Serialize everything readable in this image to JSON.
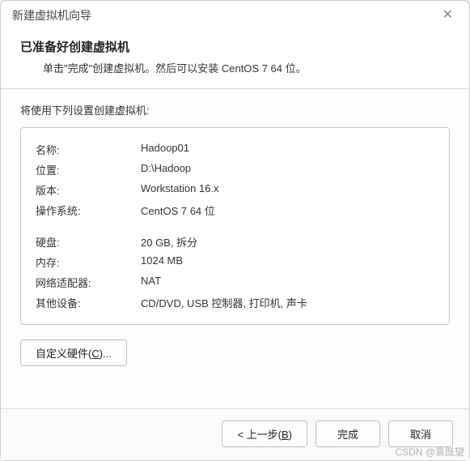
{
  "window": {
    "title": "新建虚拟机向导"
  },
  "header": {
    "title": "已准备好创建虚拟机",
    "subtitle": "单击\"完成\"创建虚拟机。然后可以安装 CentOS 7 64 位。"
  },
  "intro": "将使用下列设置创建虚拟机:",
  "settings": {
    "rows": [
      {
        "label": "名称:",
        "value": "Hadoop01"
      },
      {
        "label": "位置:",
        "value": "D:\\Hadoop"
      },
      {
        "label": "版本:",
        "value": "Workstation 16.x"
      },
      {
        "label": "操作系统:",
        "value": "CentOS 7 64 位"
      }
    ],
    "rows2": [
      {
        "label": "硬盘:",
        "value": "20 GB, 拆分"
      },
      {
        "label": "内存:",
        "value": "1024 MB"
      },
      {
        "label": "网络适配器:",
        "value": "NAT"
      },
      {
        "label": "其他设备:",
        "value": "CD/DVD, USB 控制器, 打印机, 声卡"
      }
    ]
  },
  "buttons": {
    "customize_pre": "自定义硬件(",
    "customize_key": "C",
    "customize_post": ")...",
    "back_pre": "< 上一步(",
    "back_key": "B",
    "back_post": ")",
    "finish": "完成",
    "cancel": "取消"
  },
  "watermark": "CSDN @袁既望"
}
